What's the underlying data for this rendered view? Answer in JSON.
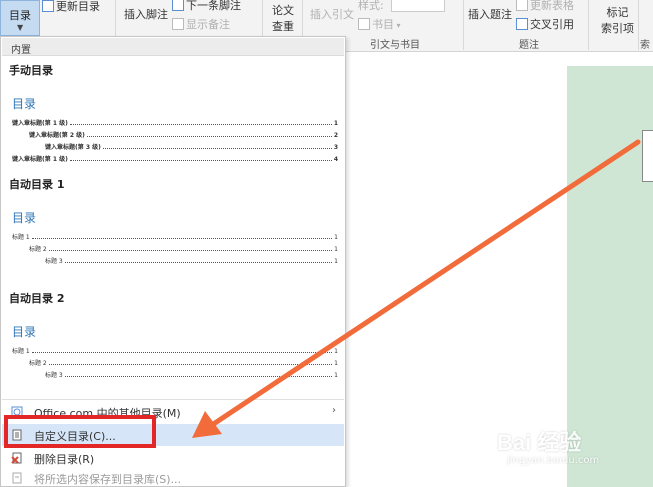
{
  "ribbon": {
    "toc_label": "目录",
    "update_toc": "更新目录",
    "insert_footnote": "插入脚注",
    "next_footnote": "下一条脚注",
    "show_notes": "显示备注",
    "paper_check_1": "论文",
    "paper_check_2": "查重",
    "insert_citation": "插入引文",
    "style": "样式:",
    "bibliography": "书目",
    "group_citations": "引文与书目",
    "insert_caption": "插入题注",
    "update_table": "更新表格",
    "cross_reference": "交叉引用",
    "group_captions": "题注",
    "mark_entry_1": "标记",
    "mark_entry_2": "索引项",
    "group_index": "索引"
  },
  "dropdown": {
    "section_header": "内置",
    "manual_toc": {
      "title": "手动目录",
      "heading": "目录",
      "entries": [
        {
          "text": "键入章标题(第 1 级)",
          "page": "1"
        },
        {
          "text": "键入章标题(第 2 级)",
          "page": "2"
        },
        {
          "text": "键入章标题(第 3 级)",
          "page": "3"
        },
        {
          "text": "键入章标题(第 1 级)",
          "page": "4"
        }
      ]
    },
    "auto_toc_1": {
      "title": "自动目录 1",
      "heading": "目录",
      "entries": [
        {
          "text": "标题 1",
          "page": "1"
        },
        {
          "text": "标题 2",
          "page": "1"
        },
        {
          "text": "标题 3",
          "page": "1"
        }
      ]
    },
    "auto_toc_2": {
      "title": "自动目录 2",
      "heading": "目录",
      "entries": [
        {
          "text": "标题 1",
          "page": "1"
        },
        {
          "text": "标题 2",
          "page": "1"
        },
        {
          "text": "标题 3",
          "page": "1"
        }
      ]
    },
    "menu": {
      "office_more": "Office.com 中的其他目录(M)",
      "custom_toc": "自定义目录(C)...",
      "remove_toc": "删除目录(R)",
      "save_selection": "将所选内容保存到目录库(S)..."
    }
  },
  "watermark": {
    "brand": "Bai 经验",
    "url": "jingyan.baidu.com"
  },
  "colors": {
    "highlight_red": "#e32626",
    "arrow_orange": "#f26b3a",
    "toc_blue": "#2e74b5",
    "page_green": "#cfe6d4"
  }
}
